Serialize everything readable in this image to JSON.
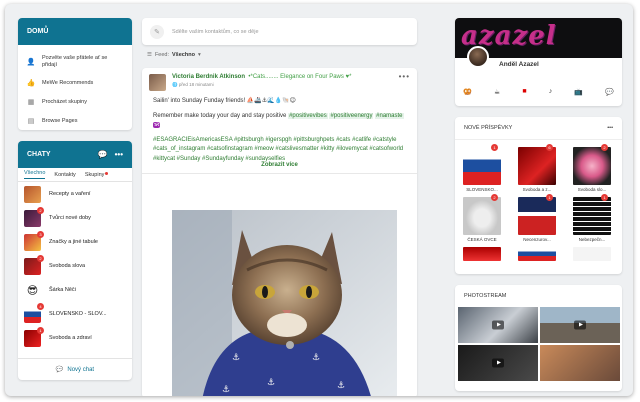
{
  "home": {
    "title": "DOMŮ",
    "items": [
      {
        "label": "Pozvěte vaše přátele ať se přidají",
        "icon": "add-user-icon"
      },
      {
        "label": "MeWe Recommends",
        "icon": "thumb-icon"
      },
      {
        "label": "Procházet skupiny",
        "icon": "groups-icon"
      },
      {
        "label": "Browse Pages",
        "icon": "pages-icon"
      }
    ]
  },
  "chats": {
    "title": "CHATY",
    "tabs": [
      "Všechno",
      "Kontakty",
      "Skupiny"
    ],
    "items": [
      {
        "label": "Recepty a vaření",
        "badge": ""
      },
      {
        "label": "Tvůrci nové doby",
        "badge": "2"
      },
      {
        "label": "Značky a jiné tabule",
        "badge": "3"
      },
      {
        "label": "Svoboda slova",
        "badge": "2"
      },
      {
        "label": "Šárka Něči",
        "badge": ""
      },
      {
        "label": "SLOVENSKO - SLOV...",
        "badge": "4"
      },
      {
        "label": "Svoboda a zdraví",
        "badge": "1"
      }
    ],
    "new_chat": "Nový chat"
  },
  "compose": {
    "placeholder": "Sdělte vašim kontaktům, co se děje"
  },
  "feed": {
    "label": "Feed:",
    "value": "Všechno"
  },
  "post": {
    "author": "Victoria Berdnik Atkinson",
    "group": "*Cats........ Elegance on Four Paws ♥*",
    "time": "před 18 minutami",
    "line1": "Sailin' into Sunday Funday friends! ⛵🚢⚓🌊💧🐚😊",
    "line2_text": "Remember make today your day and stay positive",
    "line2_tags": [
      "#positivevibes",
      "#positiveenergy",
      "#namaste"
    ],
    "tags": "#ESAGRACIEisAmericasESA #pittsburgh #igerspgh #pittsburghpets #cats #catlife #catstyle #cats_of_instagram #catsofinstagram #meow #catslivesmatter #kitty #ilovemycat #catsofworld #kittycat #Sunday #Sundayfunday #sundayselfies",
    "show_more": "Zobrazit více"
  },
  "profile": {
    "banner_text": "azazel",
    "name": "Anděl Azazel"
  },
  "new_posts": {
    "title": "NOVÉ PŘÍSPĚVKY",
    "items": [
      {
        "label": "SLOVENSKO...",
        "badge": "1"
      },
      {
        "label": "Svoboda a z...",
        "badge": "6"
      },
      {
        "label": "Svoboda slo...",
        "badge": "2"
      },
      {
        "label": "ČESKÁ OVCE",
        "badge": "2"
      },
      {
        "label": "Necenzurov...",
        "badge": "1"
      },
      {
        "label": "Nebezpečn...",
        "badge": "1"
      }
    ]
  },
  "photostream": {
    "title": "PHOTOSTREAM"
  }
}
